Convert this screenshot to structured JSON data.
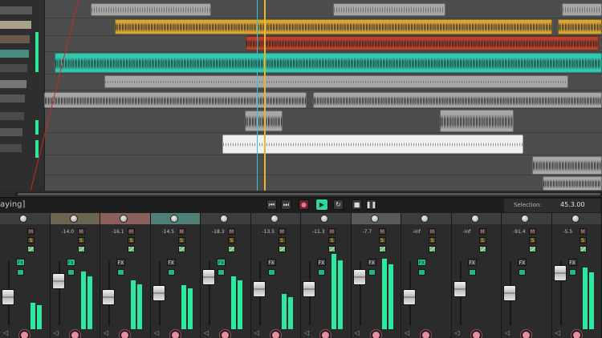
{
  "transport": {
    "play_state": "aying]",
    "buttons": [
      {
        "name": "skip-back-icon",
        "glyph": "⏮"
      },
      {
        "name": "skip-forward-icon",
        "glyph": "⏭"
      },
      {
        "name": "record-icon",
        "glyph": "●"
      },
      {
        "name": "play-icon",
        "glyph": "▶"
      },
      {
        "name": "loop-icon",
        "glyph": "↻"
      },
      {
        "name": "stop-icon",
        "glyph": "■"
      },
      {
        "name": "pause-icon",
        "glyph": "❚❚"
      }
    ],
    "selection_label": "Selection:",
    "selection_value": "45.3.00"
  },
  "mixer": {
    "strips": [
      {
        "db": "",
        "m": "M",
        "s": "S",
        "fx": "FX",
        "fx_on": true,
        "meter": 0.3,
        "fader": 0.55
      },
      {
        "db": "-14.0",
        "m": "M",
        "s": "S",
        "fx": "FX",
        "fx_on": true,
        "meter": 0.65,
        "fader": 0.35
      },
      {
        "db": "-16.1",
        "m": "M",
        "s": "S",
        "fx": "FX",
        "fx_on": false,
        "meter": 0.55,
        "fader": 0.55
      },
      {
        "db": "-14.5",
        "m": "M",
        "s": "S",
        "fx": "FX",
        "fx_on": false,
        "meter": 0.5,
        "fader": 0.5
      },
      {
        "db": "-18.3",
        "m": "M",
        "s": "S",
        "fx": "FX",
        "fx_on": true,
        "meter": 0.6,
        "fader": 0.3
      },
      {
        "db": "-13.5",
        "m": "M",
        "s": "S",
        "fx": "FX",
        "fx_on": false,
        "meter": 0.4,
        "fader": 0.45
      },
      {
        "db": "-11.3",
        "m": "M",
        "s": "S",
        "fx": "FX",
        "fx_on": false,
        "meter": 0.85,
        "fader": 0.45
      },
      {
        "db": "-7.7",
        "m": "M",
        "s": "S",
        "fx": "FX",
        "fx_on": false,
        "meter": 0.8,
        "fader": 0.3
      },
      {
        "db": "-inf",
        "m": "M",
        "s": "S",
        "fx": "FX",
        "fx_on": true,
        "meter": 0.0,
        "fader": 0.55
      },
      {
        "db": "-inf",
        "m": "M",
        "s": "S",
        "fx": "FX",
        "fx_on": false,
        "meter": 0.0,
        "fader": 0.45
      },
      {
        "db": "-91.4",
        "m": "M",
        "s": "S",
        "fx": "FX",
        "fx_on": false,
        "meter": 0.0,
        "fader": 0.5
      },
      {
        "db": "-5.5",
        "m": "M",
        "s": "S",
        "fx": "FX",
        "fx_on": false,
        "meter": 0.7,
        "fader": 0.25
      }
    ]
  },
  "colors": {
    "accent_teal": "#2ee8a0",
    "item_yellow": "#d9a638",
    "item_red": "#b8442c",
    "item_teal": "#35c7ae",
    "item_gray": "#a7a7a7",
    "item_white": "#f0f0f0",
    "cursor_red": "#d8242a",
    "cursor_orange": "#f0b429",
    "cursor_cyan": "#27c7d8"
  }
}
